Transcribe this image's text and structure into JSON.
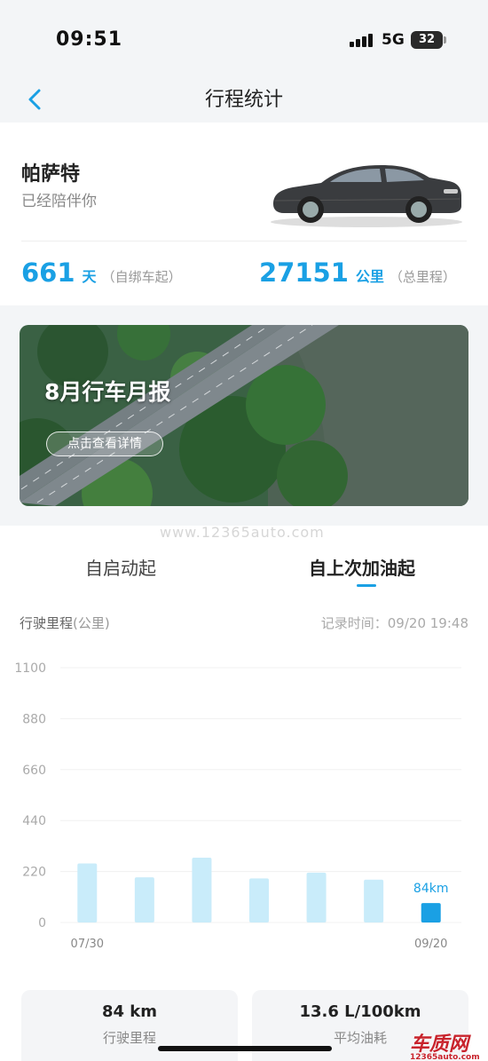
{
  "status_bar": {
    "time": "09:51",
    "network": "5G",
    "battery": "32"
  },
  "nav": {
    "title": "行程统计"
  },
  "vehicle": {
    "name": "帕萨特",
    "subtitle": "已经陪伴你",
    "days_value": "661",
    "days_unit": "天",
    "days_note": "（自绑车起）",
    "mileage_value": "27151",
    "mileage_unit": "公里",
    "mileage_note": "（总里程）"
  },
  "banner": {
    "title": "8月行车月报",
    "button": "点击查看详情"
  },
  "watermark": "www.12365auto.com",
  "tabs": [
    {
      "label": "自启动起",
      "active": false
    },
    {
      "label": "自上次加油起",
      "active": true
    }
  ],
  "chart_header": {
    "label": "行驶里程",
    "unit": "(公里)",
    "record_time": "记录时间：09/20 19:48"
  },
  "chart_data": {
    "type": "bar",
    "categories": [
      "07/30",
      "",
      "",
      "",
      "",
      "",
      "09/20"
    ],
    "values": [
      255,
      195,
      280,
      190,
      215,
      185,
      84
    ],
    "yticks": [
      0,
      220,
      440,
      660,
      880,
      1100
    ],
    "ylim": [
      0,
      1100
    ],
    "last_value_label": "84km",
    "colors": {
      "bar": "#c9ecfa",
      "highlight": "#1aa0e4",
      "grid": "#f0f0f0",
      "tick": "#aaa"
    }
  },
  "metrics": [
    {
      "value": "84 km",
      "label": "行驶里程"
    },
    {
      "value": "13.6 L/100km",
      "label": "平均油耗"
    }
  ],
  "logo": {
    "text": "车质网",
    "sub": "12365auto.com"
  }
}
